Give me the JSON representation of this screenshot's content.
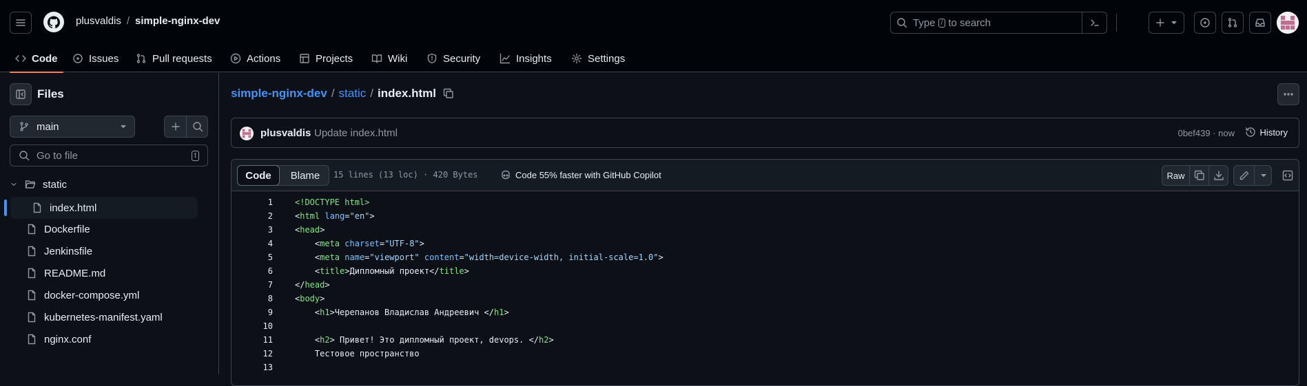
{
  "header": {
    "owner": "plusvaldis",
    "separator": "/",
    "repo": "simple-nginx-dev",
    "search_prefix": "Type",
    "search_key": "/",
    "search_suffix": "to search"
  },
  "nav": {
    "tabs": [
      {
        "label": "Code",
        "icon": "code-icon"
      },
      {
        "label": "Issues",
        "icon": "issue-icon"
      },
      {
        "label": "Pull requests",
        "icon": "pull-request-icon"
      },
      {
        "label": "Actions",
        "icon": "play-icon"
      },
      {
        "label": "Projects",
        "icon": "table-icon"
      },
      {
        "label": "Wiki",
        "icon": "book-icon"
      },
      {
        "label": "Security",
        "icon": "shield-icon"
      },
      {
        "label": "Insights",
        "icon": "graph-icon"
      },
      {
        "label": "Settings",
        "icon": "gear-icon"
      }
    ]
  },
  "sidebar": {
    "title": "Files",
    "branch": "main",
    "goto_placeholder": "Go to file",
    "goto_key": "t",
    "folder": "static",
    "items": [
      "index.html",
      "Dockerfile",
      "Jenkinsfile",
      "README.md",
      "docker-compose.yml",
      "kubernetes-manifest.yaml",
      "nginx.conf"
    ]
  },
  "breadcrumb": {
    "repo": "simple-nginx-dev",
    "folder": "static",
    "sep": "/",
    "file": "index.html"
  },
  "commit": {
    "author": "plusvaldis",
    "message": "Update index.html",
    "sha_time": "0bef439 · now",
    "history_label": "History"
  },
  "file": {
    "tab_code": "Code",
    "tab_blame": "Blame",
    "meta": "15 lines (13 loc) · 420 Bytes",
    "copilot": "Code 55% faster with GitHub Copilot",
    "raw": "Raw",
    "lines": [
      "<!DOCTYPE html>",
      "<html lang=\"en\">",
      "<head>",
      "    <meta charset=\"UTF-8\">",
      "    <meta name=\"viewport\" content=\"width=device-width, initial-scale=1.0\">",
      "    <title>Дипломный проект</title>",
      "</head>",
      "<body>",
      "    <h1>Черепанов Владислав Андреевич </h1>",
      "",
      "    <h2> Привет! Это дипломный проект, devops. </h2>",
      "    Тестовое пространство",
      ""
    ]
  },
  "colors": {
    "accent": "#4493f8",
    "tab_underline": "#f78166",
    "tag": "#7ee787",
    "attr": "#79c0ff",
    "string": "#a5d6ff"
  }
}
